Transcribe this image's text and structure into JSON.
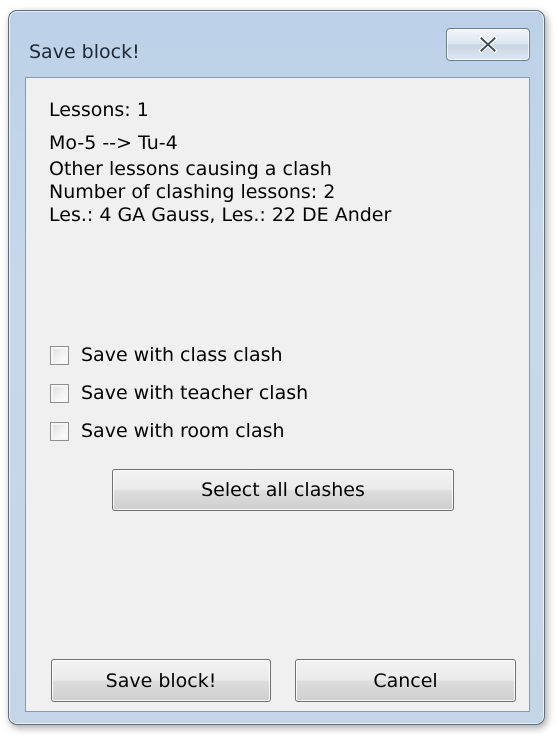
{
  "window": {
    "title": "Save block!"
  },
  "info": {
    "lessons": "Lessons: 1",
    "move": "Mo-5 --> Tu-4",
    "clash_heading": "Other lessons causing a clash",
    "clash_count": "Number of clashing lessons: 2",
    "clash_list": "Les.: 4 GA Gauss, Les.: 22 DE Ander"
  },
  "options": [
    {
      "label": "Save with class clash",
      "checked": false
    },
    {
      "label": "Save with teacher clash",
      "checked": false
    },
    {
      "label": "Save with room clash",
      "checked": false
    }
  ],
  "buttons": {
    "select_all": "Select all clashes",
    "save": "Save block!",
    "cancel": "Cancel"
  },
  "icons": {
    "close": "close-icon"
  }
}
